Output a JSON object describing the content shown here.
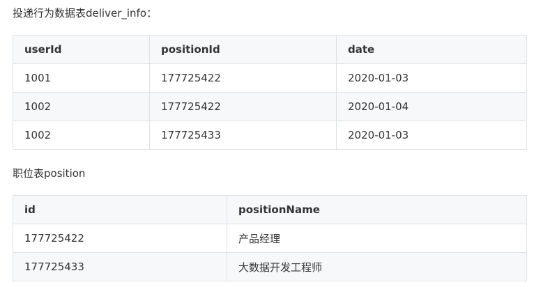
{
  "deliver_section": {
    "caption": "投递行为数据表deliver_info：",
    "headers": [
      "userId",
      "positionId",
      "date"
    ],
    "rows": [
      [
        "1001",
        "177725422",
        "2020-01-03"
      ],
      [
        "1002",
        "177725422",
        "2020-01-04"
      ],
      [
        "1002",
        "177725433",
        "2020-01-03"
      ]
    ]
  },
  "position_section": {
    "caption": "职位表position",
    "headers": [
      "id",
      "positionName"
    ],
    "rows": [
      [
        "177725422",
        "产品经理"
      ],
      [
        "177725433",
        "大数据开发工程师"
      ]
    ]
  },
  "colors": {
    "header_bg": "#f6f8fa",
    "border": "#dfe2e5",
    "text": "#333333"
  }
}
